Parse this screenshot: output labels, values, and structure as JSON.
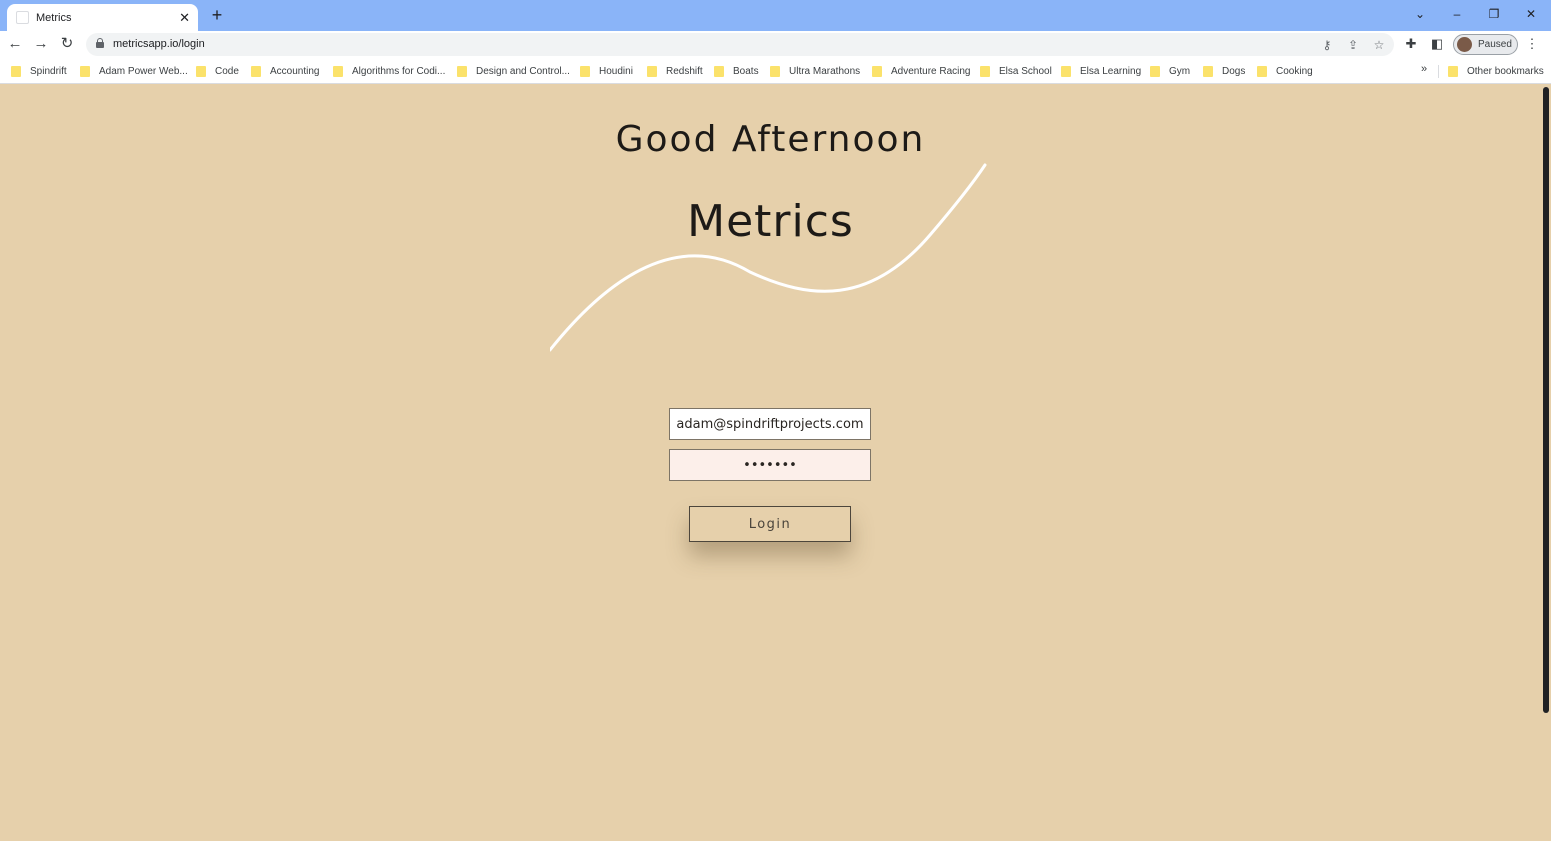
{
  "browser": {
    "tab": {
      "title": "Metrics",
      "close_icon": "close-icon"
    },
    "new_tab_label": "+",
    "window_controls": {
      "tab_search": "⌄",
      "minimize": "–",
      "restore": "❐",
      "close": "✕"
    },
    "address_bar": {
      "url": "metricsapp.io/login"
    },
    "profile": {
      "label": "Paused"
    },
    "bookmarks": [
      "Spindrift",
      "Adam Power Web...",
      "Code",
      "Accounting",
      "Algorithms for Codi...",
      "Design and Control...",
      "Houdini",
      "Redshift",
      "Boats",
      "Ultra Marathons",
      "Adventure Racing",
      "Elsa School",
      "Elsa Learning",
      "Gym",
      "Dogs",
      "Cooking"
    ],
    "bookmarks_overflow": "»",
    "other_bookmarks": "Other bookmarks"
  },
  "page": {
    "greeting": "Good Afternoon",
    "app_title": "Metrics",
    "email_value": "adam@spindriftprojects.com",
    "password_value": "•••••••",
    "login_label": "Login"
  },
  "colors": {
    "background": "#e6d0ab",
    "tabstrip": "#8ab4f8",
    "password_field": "#fcefea",
    "swoosh": "#ffffff"
  }
}
